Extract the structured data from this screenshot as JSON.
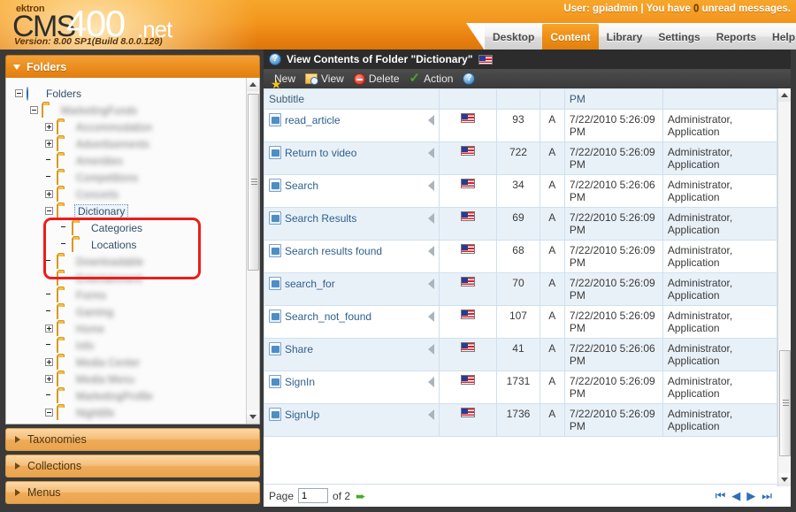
{
  "brand": {
    "ektron": "ektron",
    "cms": "CMS",
    "four": "400",
    "net": ".net",
    "version": "Version: 8.00 SP1(Build 8.0.0.128)"
  },
  "header": {
    "user_prefix": "User: ",
    "user_name": "gpiadmin",
    "separator": " | ",
    "messages_prefix": "You have ",
    "messages_count": "0",
    "messages_suffix": " unread messages.",
    "accent_orange": "#ec8c1b",
    "active_tab_color": "#ef8e16"
  },
  "nav": {
    "items": [
      {
        "label": "Desktop",
        "active": false
      },
      {
        "label": "Content",
        "active": true
      },
      {
        "label": "Library",
        "active": false
      },
      {
        "label": "Settings",
        "active": false
      },
      {
        "label": "Reports",
        "active": false
      },
      {
        "label": "Help",
        "active": false
      }
    ]
  },
  "sidebar": {
    "panel_title": "Folders",
    "root_label": "Folders",
    "tree": [
      {
        "label": "Folders",
        "indent": 0,
        "expander": "minus",
        "icon": "globe-icon",
        "blurred": false,
        "selected": false
      },
      {
        "label": "MarketingFunds",
        "indent": 1,
        "expander": "minus",
        "icon": "folder-open-icon",
        "blurred": true,
        "selected": false
      },
      {
        "label": "Accommodation",
        "indent": 2,
        "expander": "plus",
        "icon": "folder-icon",
        "blurred": true,
        "selected": false
      },
      {
        "label": "Advertisements",
        "indent": 2,
        "expander": "plus",
        "icon": "folder-icon",
        "blurred": true,
        "selected": false
      },
      {
        "label": "Amenities",
        "indent": 2,
        "expander": "none",
        "icon": "folder-icon",
        "blurred": true,
        "selected": false
      },
      {
        "label": "Competitions",
        "indent": 2,
        "expander": "none",
        "icon": "folder-icon",
        "blurred": true,
        "selected": false
      },
      {
        "label": "Concerts",
        "indent": 2,
        "expander": "plus",
        "icon": "folder-icon",
        "blurred": true,
        "selected": false
      },
      {
        "label": "Dictionary",
        "indent": 2,
        "expander": "minus",
        "icon": "folder-open-icon",
        "blurred": false,
        "selected": true
      },
      {
        "label": "Categories",
        "indent": 3,
        "expander": "none",
        "icon": "folder-icon",
        "blurred": false,
        "selected": false
      },
      {
        "label": "Locations",
        "indent": 3,
        "expander": "none",
        "icon": "folder-icon",
        "blurred": false,
        "selected": false
      },
      {
        "label": "Downloadable",
        "indent": 2,
        "expander": "none",
        "icon": "folder-icon",
        "blurred": true,
        "selected": false
      },
      {
        "label": "Entertainment",
        "indent": 2,
        "expander": "none",
        "icon": "folder-icon",
        "blurred": true,
        "selected": false
      },
      {
        "label": "Forms",
        "indent": 2,
        "expander": "none",
        "icon": "folder-icon",
        "blurred": true,
        "selected": false
      },
      {
        "label": "Gaming",
        "indent": 2,
        "expander": "none",
        "icon": "folder-icon",
        "blurred": true,
        "selected": false
      },
      {
        "label": "Home",
        "indent": 2,
        "expander": "plus",
        "icon": "folder-icon",
        "blurred": true,
        "selected": false
      },
      {
        "label": "Info",
        "indent": 2,
        "expander": "none",
        "icon": "folder-icon",
        "blurred": true,
        "selected": false
      },
      {
        "label": "Media Center",
        "indent": 2,
        "expander": "plus",
        "icon": "folder-icon",
        "blurred": true,
        "selected": false
      },
      {
        "label": "Media Menu",
        "indent": 2,
        "expander": "plus",
        "icon": "folder-icon",
        "blurred": true,
        "selected": false
      },
      {
        "label": "MarketingProfile",
        "indent": 2,
        "expander": "none",
        "icon": "folder-icon",
        "blurred": true,
        "selected": false
      },
      {
        "label": "Nightlife",
        "indent": 2,
        "expander": "minus",
        "icon": "folder-icon",
        "blurred": true,
        "selected": false
      }
    ],
    "accordions": [
      {
        "label": "Taxonomies"
      },
      {
        "label": "Collections"
      },
      {
        "label": "Menus"
      }
    ]
  },
  "content": {
    "title": "View Contents of Folder \"Dictionary\"",
    "title_flag": "us-flag-icon",
    "toolbar": [
      {
        "label": "New",
        "icon": "star-icon"
      },
      {
        "label": "View",
        "icon": "folder-search-icon"
      },
      {
        "label": "Delete",
        "icon": "delete-circle-icon"
      },
      {
        "label": "Action",
        "icon": "green-check-icon"
      },
      {
        "label": "",
        "icon": "help-icon"
      }
    ],
    "columns": [
      "Subtitle",
      "",
      "",
      "",
      "",
      ""
    ],
    "partial_header": "Subtitle",
    "partial_top_row": {
      "date_tail": "PM",
      "author_tail": ""
    },
    "rows": [
      {
        "title": "read_article",
        "lang": "us-flag-icon",
        "id": "93",
        "status": "A",
        "date": "7/22/2010 5:26:09 PM",
        "author": "Administrator, Application",
        "alt": false
      },
      {
        "title": "Return to video",
        "lang": "us-flag-icon",
        "id": "722",
        "status": "A",
        "date": "7/22/2010 5:26:09 PM",
        "author": "Administrator, Application",
        "alt": true
      },
      {
        "title": "Search",
        "lang": "us-flag-icon",
        "id": "34",
        "status": "A",
        "date": "7/22/2010 5:26:06 PM",
        "author": "Administrator, Application",
        "alt": false
      },
      {
        "title": "Search Results",
        "lang": "us-flag-icon",
        "id": "69",
        "status": "A",
        "date": "7/22/2010 5:26:09 PM",
        "author": "Administrator, Application",
        "alt": true
      },
      {
        "title": "Search results found",
        "lang": "us-flag-icon",
        "id": "68",
        "status": "A",
        "date": "7/22/2010 5:26:09 PM",
        "author": "Administrator, Application",
        "alt": false
      },
      {
        "title": "search_for",
        "lang": "us-flag-icon",
        "id": "70",
        "status": "A",
        "date": "7/22/2010 5:26:09 PM",
        "author": "Administrator, Application",
        "alt": true
      },
      {
        "title": "Search_not_found",
        "lang": "us-flag-icon",
        "id": "107",
        "status": "A",
        "date": "7/22/2010 5:26:09 PM",
        "author": "Administrator, Application",
        "alt": false
      },
      {
        "title": "Share",
        "lang": "us-flag-icon",
        "id": "41",
        "status": "A",
        "date": "7/22/2010 5:26:06 PM",
        "author": "Administrator, Application",
        "alt": true
      },
      {
        "title": "SignIn",
        "lang": "us-flag-icon",
        "id": "1731",
        "status": "A",
        "date": "7/22/2010 5:26:09 PM",
        "author": "Administrator, Application",
        "alt": false
      },
      {
        "title": "SignUp",
        "lang": "us-flag-icon",
        "id": "1736",
        "status": "A",
        "date": "7/22/2010 5:26:09 PM",
        "author": "Administrator, Application",
        "alt": true
      }
    ],
    "pager": {
      "page_label": "Page",
      "page_value": "1",
      "of_label": "of 2",
      "go_icon": "green-right-arrow-icon",
      "first_icon": "first-page-icon",
      "prev_icon": "prev-page-icon",
      "next_icon": "next-page-icon",
      "last_icon": "last-page-icon"
    }
  }
}
